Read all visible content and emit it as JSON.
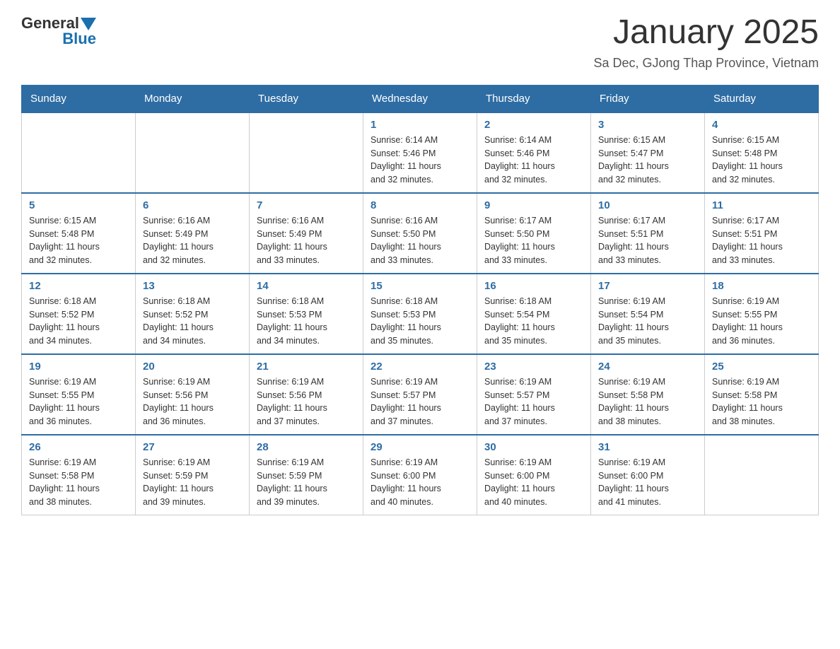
{
  "logo": {
    "text_general": "General",
    "text_blue": "Blue"
  },
  "header": {
    "month": "January 2025",
    "location": "Sa Dec, GJong Thap Province, Vietnam"
  },
  "weekdays": [
    "Sunday",
    "Monday",
    "Tuesday",
    "Wednesday",
    "Thursday",
    "Friday",
    "Saturday"
  ],
  "weeks": [
    [
      {
        "day": "",
        "info": ""
      },
      {
        "day": "",
        "info": ""
      },
      {
        "day": "",
        "info": ""
      },
      {
        "day": "1",
        "info": "Sunrise: 6:14 AM\nSunset: 5:46 PM\nDaylight: 11 hours\nand 32 minutes."
      },
      {
        "day": "2",
        "info": "Sunrise: 6:14 AM\nSunset: 5:46 PM\nDaylight: 11 hours\nand 32 minutes."
      },
      {
        "day": "3",
        "info": "Sunrise: 6:15 AM\nSunset: 5:47 PM\nDaylight: 11 hours\nand 32 minutes."
      },
      {
        "day": "4",
        "info": "Sunrise: 6:15 AM\nSunset: 5:48 PM\nDaylight: 11 hours\nand 32 minutes."
      }
    ],
    [
      {
        "day": "5",
        "info": "Sunrise: 6:15 AM\nSunset: 5:48 PM\nDaylight: 11 hours\nand 32 minutes."
      },
      {
        "day": "6",
        "info": "Sunrise: 6:16 AM\nSunset: 5:49 PM\nDaylight: 11 hours\nand 32 minutes."
      },
      {
        "day": "7",
        "info": "Sunrise: 6:16 AM\nSunset: 5:49 PM\nDaylight: 11 hours\nand 33 minutes."
      },
      {
        "day": "8",
        "info": "Sunrise: 6:16 AM\nSunset: 5:50 PM\nDaylight: 11 hours\nand 33 minutes."
      },
      {
        "day": "9",
        "info": "Sunrise: 6:17 AM\nSunset: 5:50 PM\nDaylight: 11 hours\nand 33 minutes."
      },
      {
        "day": "10",
        "info": "Sunrise: 6:17 AM\nSunset: 5:51 PM\nDaylight: 11 hours\nand 33 minutes."
      },
      {
        "day": "11",
        "info": "Sunrise: 6:17 AM\nSunset: 5:51 PM\nDaylight: 11 hours\nand 33 minutes."
      }
    ],
    [
      {
        "day": "12",
        "info": "Sunrise: 6:18 AM\nSunset: 5:52 PM\nDaylight: 11 hours\nand 34 minutes."
      },
      {
        "day": "13",
        "info": "Sunrise: 6:18 AM\nSunset: 5:52 PM\nDaylight: 11 hours\nand 34 minutes."
      },
      {
        "day": "14",
        "info": "Sunrise: 6:18 AM\nSunset: 5:53 PM\nDaylight: 11 hours\nand 34 minutes."
      },
      {
        "day": "15",
        "info": "Sunrise: 6:18 AM\nSunset: 5:53 PM\nDaylight: 11 hours\nand 35 minutes."
      },
      {
        "day": "16",
        "info": "Sunrise: 6:18 AM\nSunset: 5:54 PM\nDaylight: 11 hours\nand 35 minutes."
      },
      {
        "day": "17",
        "info": "Sunrise: 6:19 AM\nSunset: 5:54 PM\nDaylight: 11 hours\nand 35 minutes."
      },
      {
        "day": "18",
        "info": "Sunrise: 6:19 AM\nSunset: 5:55 PM\nDaylight: 11 hours\nand 36 minutes."
      }
    ],
    [
      {
        "day": "19",
        "info": "Sunrise: 6:19 AM\nSunset: 5:55 PM\nDaylight: 11 hours\nand 36 minutes."
      },
      {
        "day": "20",
        "info": "Sunrise: 6:19 AM\nSunset: 5:56 PM\nDaylight: 11 hours\nand 36 minutes."
      },
      {
        "day": "21",
        "info": "Sunrise: 6:19 AM\nSunset: 5:56 PM\nDaylight: 11 hours\nand 37 minutes."
      },
      {
        "day": "22",
        "info": "Sunrise: 6:19 AM\nSunset: 5:57 PM\nDaylight: 11 hours\nand 37 minutes."
      },
      {
        "day": "23",
        "info": "Sunrise: 6:19 AM\nSunset: 5:57 PM\nDaylight: 11 hours\nand 37 minutes."
      },
      {
        "day": "24",
        "info": "Sunrise: 6:19 AM\nSunset: 5:58 PM\nDaylight: 11 hours\nand 38 minutes."
      },
      {
        "day": "25",
        "info": "Sunrise: 6:19 AM\nSunset: 5:58 PM\nDaylight: 11 hours\nand 38 minutes."
      }
    ],
    [
      {
        "day": "26",
        "info": "Sunrise: 6:19 AM\nSunset: 5:58 PM\nDaylight: 11 hours\nand 38 minutes."
      },
      {
        "day": "27",
        "info": "Sunrise: 6:19 AM\nSunset: 5:59 PM\nDaylight: 11 hours\nand 39 minutes."
      },
      {
        "day": "28",
        "info": "Sunrise: 6:19 AM\nSunset: 5:59 PM\nDaylight: 11 hours\nand 39 minutes."
      },
      {
        "day": "29",
        "info": "Sunrise: 6:19 AM\nSunset: 6:00 PM\nDaylight: 11 hours\nand 40 minutes."
      },
      {
        "day": "30",
        "info": "Sunrise: 6:19 AM\nSunset: 6:00 PM\nDaylight: 11 hours\nand 40 minutes."
      },
      {
        "day": "31",
        "info": "Sunrise: 6:19 AM\nSunset: 6:00 PM\nDaylight: 11 hours\nand 41 minutes."
      },
      {
        "day": "",
        "info": ""
      }
    ]
  ]
}
